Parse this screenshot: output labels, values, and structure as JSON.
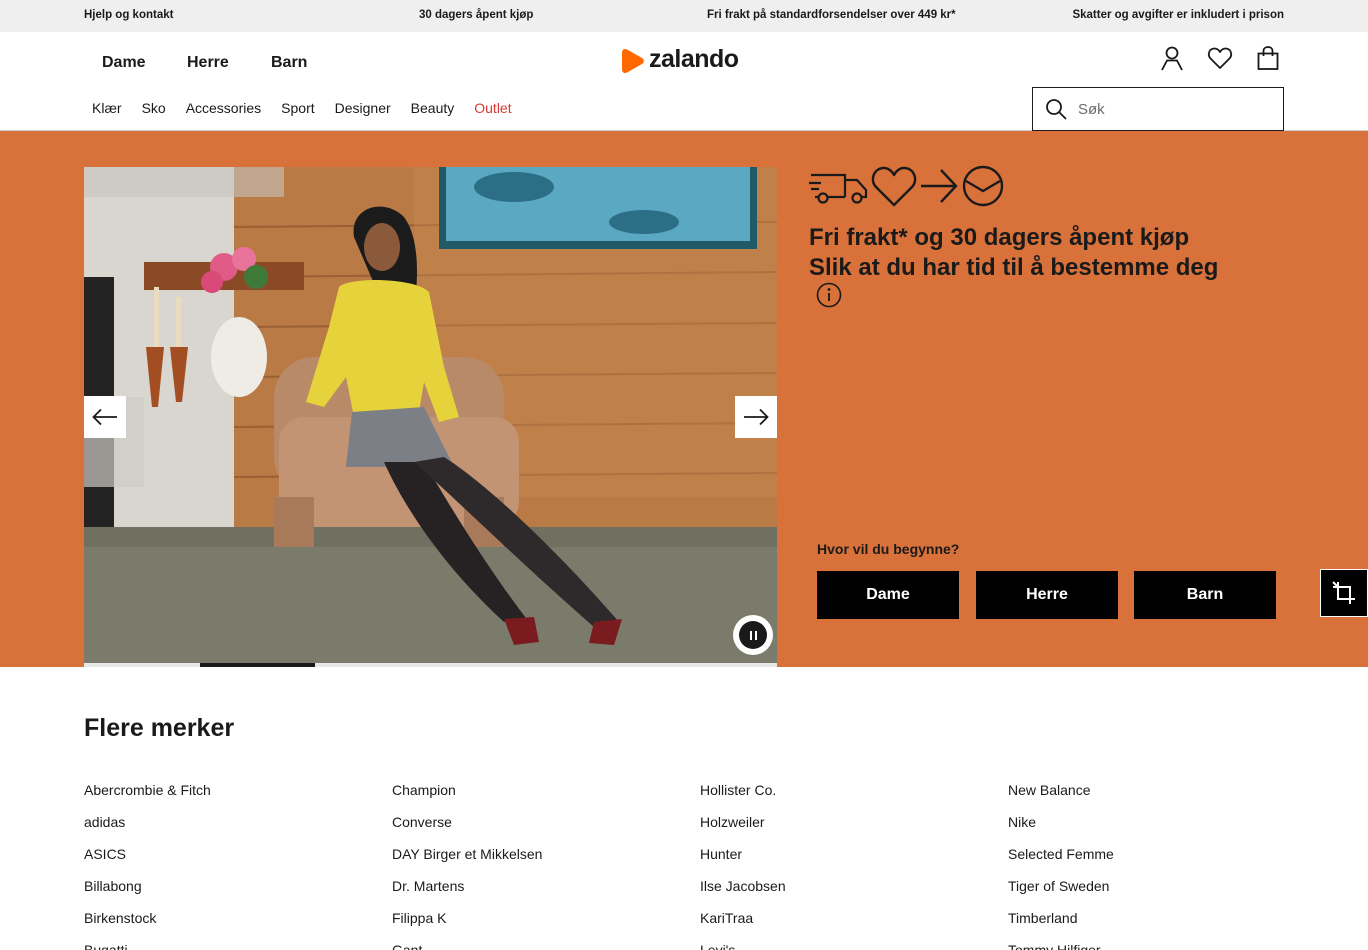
{
  "topbar": {
    "help": "Hjelp og kontakt",
    "returns": "30 dagers åpent kjøp",
    "shipping": "Fri frakt på standardforsendelser over 449 kr*",
    "taxes": "Skatter og avgifter er inkludert i prison"
  },
  "header": {
    "genders": [
      "Dame",
      "Herre",
      "Barn"
    ],
    "logo_text": "zalando",
    "brand_color": "#ff6900",
    "icons": [
      "user-icon",
      "heart-icon",
      "bag-icon"
    ],
    "categories": [
      "Klær",
      "Sko",
      "Accessories",
      "Sport",
      "Designer",
      "Beauty",
      "Outlet"
    ],
    "outlet_color": "#d83a32",
    "search": {
      "placeholder": "Søk"
    }
  },
  "hero": {
    "background": "#d8713a",
    "headline_line1": "Fri frakt* og 30 dagers åpent kjøp",
    "headline_line2": "Slik at du har tid til å bestemme deg",
    "usp_icons": [
      "truck-icon",
      "heart-icon",
      "arrow-right-icon",
      "smile-icon"
    ],
    "question": "Hvor vil du begynne?",
    "cta": [
      "Dame",
      "Herre",
      "Barn"
    ],
    "carousel": {
      "slides": 6,
      "active_slide": 2
    }
  },
  "brands": {
    "title": "Flere merker",
    "columns": [
      [
        "Abercrombie & Fitch",
        "adidas",
        "ASICS",
        "Billabong",
        "Birkenstock",
        "Bugatti"
      ],
      [
        "Champion",
        "Converse",
        "DAY Birger et Mikkelsen",
        "Dr. Martens",
        "Filippa K",
        "Gant"
      ],
      [
        "Hollister Co.",
        "Holzweiler",
        "Hunter",
        "Ilse Jacobsen",
        "KariTraa",
        "Levi's"
      ],
      [
        "New Balance",
        "Nike",
        "Selected Femme",
        "Tiger of Sweden",
        "Timberland",
        "Tommy Hilfiger"
      ]
    ]
  }
}
